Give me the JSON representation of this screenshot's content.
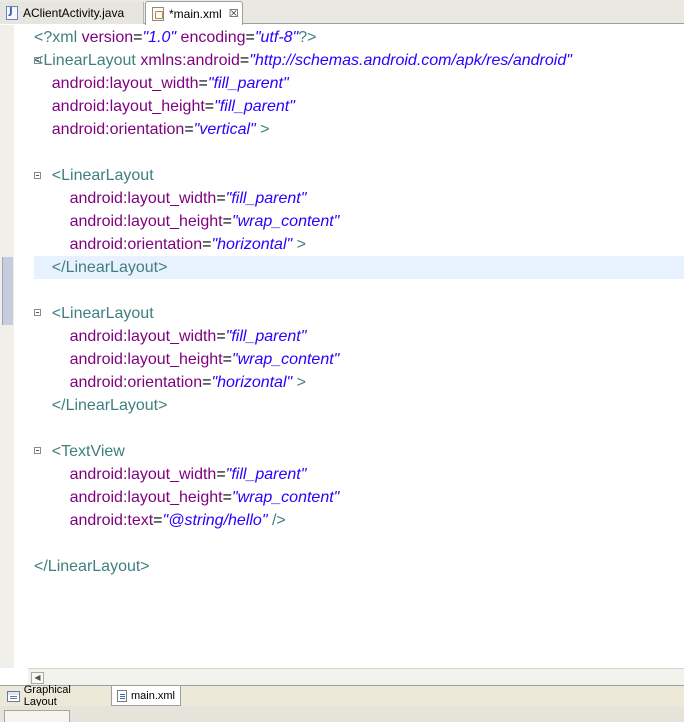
{
  "tabs": [
    {
      "label": "AClientActivity.java",
      "icon": "java-file-icon"
    },
    {
      "label": "*main.xml",
      "icon": "xml-file-icon",
      "close": "☒"
    }
  ],
  "code_lines": [
    [
      [
        "t",
        "<?xml "
      ],
      [
        "a",
        "version"
      ],
      [
        "q",
        "="
      ],
      [
        "v",
        "\"1.0\""
      ],
      [
        "a",
        " encoding"
      ],
      [
        "q",
        "="
      ],
      [
        "v",
        "\"utf-8\""
      ],
      [
        "t",
        "?>"
      ]
    ],
    [
      [
        "t",
        "<LinearLayout "
      ],
      [
        "a",
        "xmlns:android"
      ],
      [
        "q",
        "="
      ],
      [
        "v",
        "\"http://schemas.android.com/apk/res/android\""
      ]
    ],
    [
      [
        "t",
        "    "
      ],
      [
        "a",
        "android:layout_width"
      ],
      [
        "q",
        "="
      ],
      [
        "v",
        "\"fill_parent\""
      ]
    ],
    [
      [
        "t",
        "    "
      ],
      [
        "a",
        "android:layout_height"
      ],
      [
        "q",
        "="
      ],
      [
        "v",
        "\"fill_parent\""
      ]
    ],
    [
      [
        "t",
        "    "
      ],
      [
        "a",
        "android:orientation"
      ],
      [
        "q",
        "="
      ],
      [
        "v",
        "\"vertical\""
      ],
      [
        "t",
        " >"
      ]
    ],
    [],
    [
      [
        "t",
        "    <LinearLayout"
      ]
    ],
    [
      [
        "t",
        "        "
      ],
      [
        "a",
        "android:layout_width"
      ],
      [
        "q",
        "="
      ],
      [
        "v",
        "\"fill_parent\""
      ]
    ],
    [
      [
        "t",
        "        "
      ],
      [
        "a",
        "android:layout_height"
      ],
      [
        "q",
        "="
      ],
      [
        "v",
        "\"wrap_content\""
      ]
    ],
    [
      [
        "t",
        "        "
      ],
      [
        "a",
        "android:orientation"
      ],
      [
        "q",
        "="
      ],
      [
        "v",
        "\"horizontal\""
      ],
      [
        "t",
        " >"
      ]
    ],
    [
      [
        "t",
        "    </LinearLayout>"
      ]
    ],
    [],
    [
      [
        "t",
        "    <LinearLayout"
      ]
    ],
    [
      [
        "t",
        "        "
      ],
      [
        "a",
        "android:layout_width"
      ],
      [
        "q",
        "="
      ],
      [
        "v",
        "\"fill_parent\""
      ]
    ],
    [
      [
        "t",
        "        "
      ],
      [
        "a",
        "android:layout_height"
      ],
      [
        "q",
        "="
      ],
      [
        "v",
        "\"wrap_content\""
      ]
    ],
    [
      [
        "t",
        "        "
      ],
      [
        "a",
        "android:orientation"
      ],
      [
        "q",
        "="
      ],
      [
        "v",
        "\"horizontal\""
      ],
      [
        "t",
        " >"
      ]
    ],
    [
      [
        "t",
        "    </LinearLayout>"
      ]
    ],
    [],
    [
      [
        "t",
        "    <TextView"
      ]
    ],
    [
      [
        "t",
        "        "
      ],
      [
        "a",
        "android:layout_width"
      ],
      [
        "q",
        "="
      ],
      [
        "v",
        "\"fill_parent\""
      ]
    ],
    [
      [
        "t",
        "        "
      ],
      [
        "a",
        "android:layout_height"
      ],
      [
        "q",
        "="
      ],
      [
        "v",
        "\"wrap_content\""
      ]
    ],
    [
      [
        "t",
        "        "
      ],
      [
        "a",
        "android:text"
      ],
      [
        "q",
        "="
      ],
      [
        "v",
        "\"@string/hello\""
      ],
      [
        "t",
        " />"
      ]
    ],
    [],
    [
      [
        "t",
        "</LinearLayout>"
      ]
    ]
  ],
  "bottom_tabs": [
    {
      "label": "Graphical Layout",
      "icon": "layout-icon"
    },
    {
      "label": "main.xml",
      "icon": "source-icon"
    }
  ],
  "colors": {
    "tag": "#3f7f7f",
    "attribute": "#7f007f",
    "value": "#2a00ff",
    "current_line": "#e8f2fe"
  }
}
